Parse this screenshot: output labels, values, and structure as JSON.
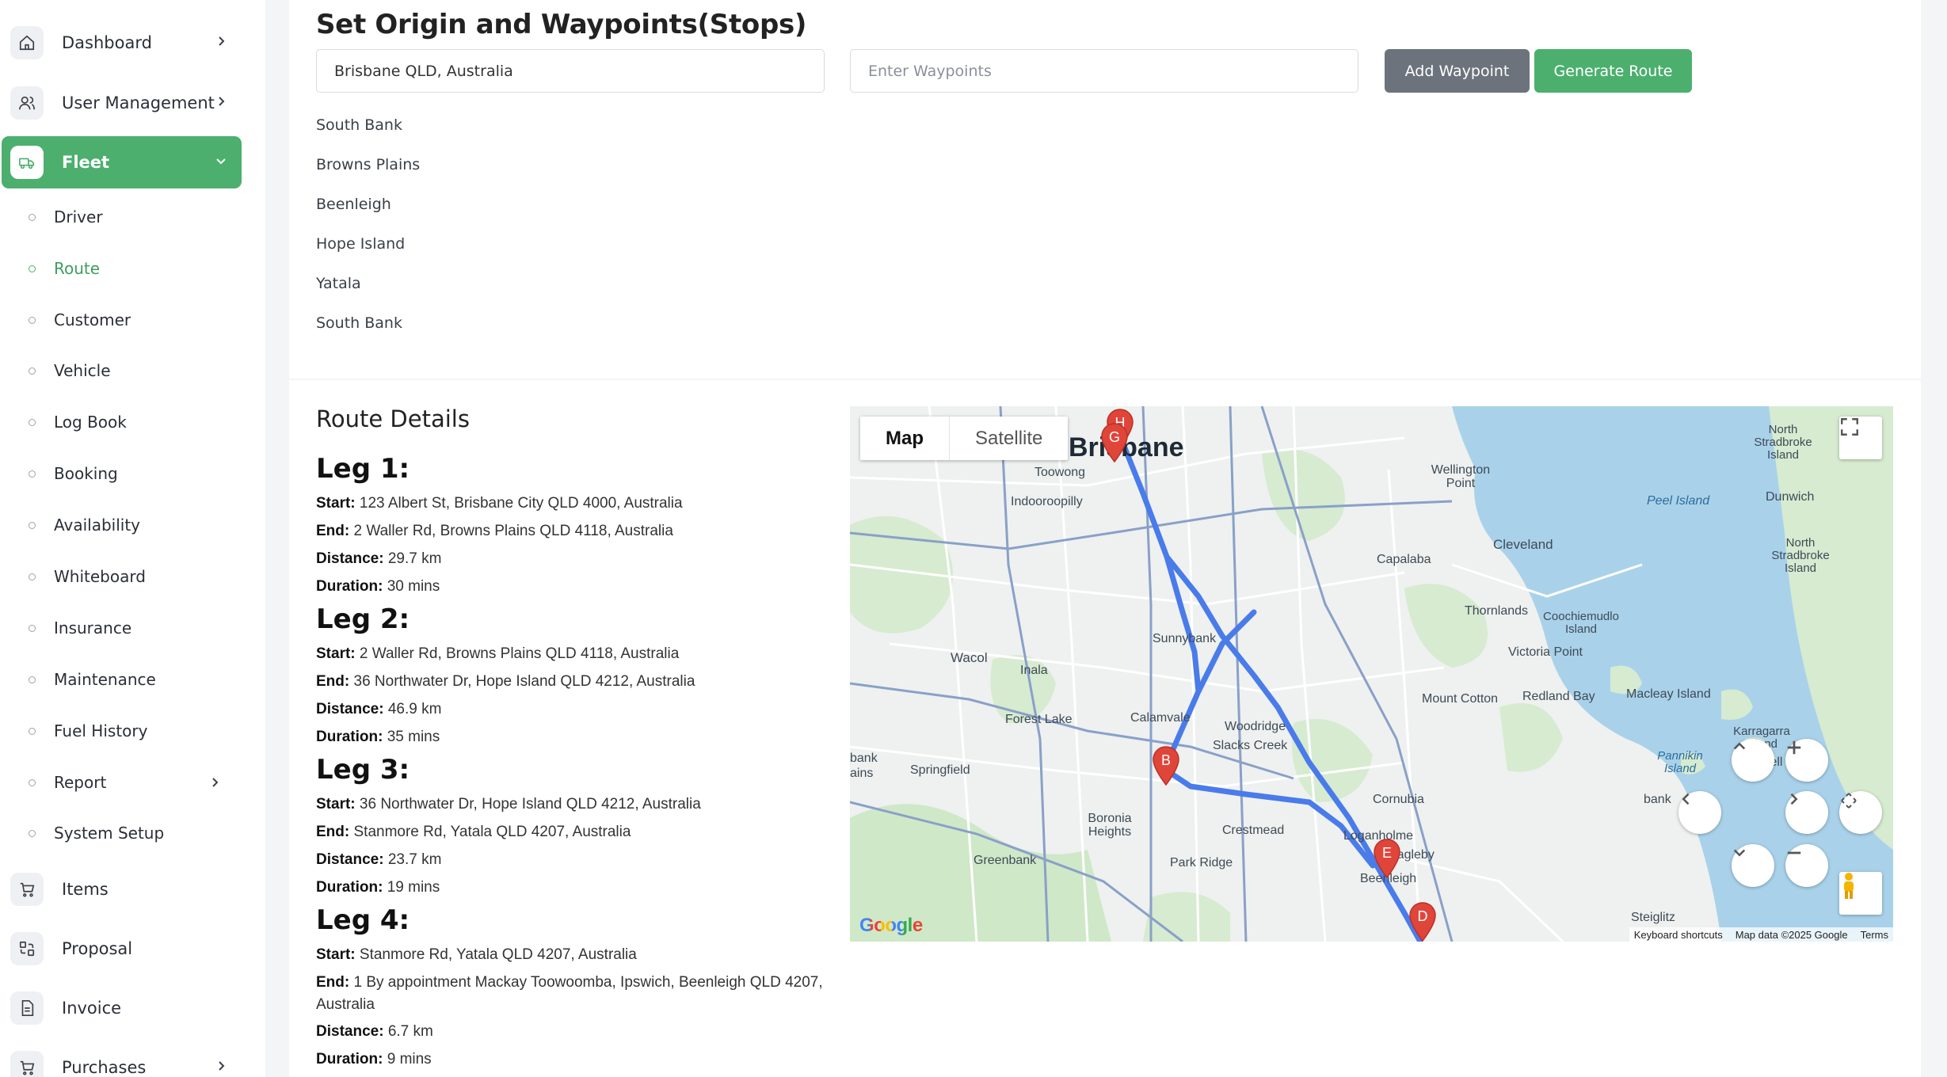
{
  "sidebar": {
    "main_items": [
      {
        "label": "Dashboard",
        "icon": "home-icon"
      },
      {
        "label": "User Management",
        "icon": "users-icon"
      },
      {
        "label": "Fleet",
        "icon": "truck-icon"
      },
      {
        "label": "Items",
        "icon": "cart-icon"
      },
      {
        "label": "Proposal",
        "icon": "proposal-icon"
      },
      {
        "label": "Invoice",
        "icon": "invoice-icon"
      },
      {
        "label": "Purchases",
        "icon": "cart-icon"
      }
    ],
    "fleet_items": [
      {
        "label": "Driver"
      },
      {
        "label": "Route"
      },
      {
        "label": "Customer"
      },
      {
        "label": "Vehicle"
      },
      {
        "label": "Log Book"
      },
      {
        "label": "Booking"
      },
      {
        "label": "Availability"
      },
      {
        "label": "Whiteboard"
      },
      {
        "label": "Insurance"
      },
      {
        "label": "Maintenance"
      },
      {
        "label": "Fuel History"
      },
      {
        "label": "Report"
      },
      {
        "label": "System Setup"
      }
    ],
    "accent": "#4caf6e"
  },
  "waypoints_form": {
    "title": "Set Origin and Waypoints(Stops)",
    "origin_value": "Brisbane QLD, Australia",
    "waypoint_placeholder": "Enter Waypoints",
    "add_label": "Add Waypoint",
    "generate_label": "Generate Route",
    "waypoints": [
      "South Bank",
      "Browns Plains",
      "Beenleigh",
      "Hope Island",
      "Yatala",
      "South Bank"
    ]
  },
  "route_details": {
    "title": "Route Details",
    "start_label": "Start:",
    "end_label": "End:",
    "distance_label": "Distance:",
    "duration_label": "Duration:",
    "legs": [
      {
        "title": "Leg 1:",
        "start": "123 Albert St, Brisbane City QLD 4000, Australia",
        "end": "2 Waller Rd, Browns Plains QLD 4118, Australia",
        "distance": "29.7 km",
        "duration": "30 mins"
      },
      {
        "title": "Leg 2:",
        "start": "2 Waller Rd, Browns Plains QLD 4118, Australia",
        "end": "36 Northwater Dr, Hope Island QLD 4212, Australia",
        "distance": "46.9 km",
        "duration": "35 mins"
      },
      {
        "title": "Leg 3:",
        "start": "36 Northwater Dr, Hope Island QLD 4212, Australia",
        "end": "Stanmore Rd, Yatala QLD 4207, Australia",
        "distance": "23.7 km",
        "duration": "19 mins"
      },
      {
        "title": "Leg 4:",
        "start": "Stanmore Rd, Yatala QLD 4207, Australia",
        "end": "1 By appointment Mackay Toowoomba, Ipswich, Beenleigh QLD 4207, Australia",
        "distance": "6.7 km",
        "duration": "9 mins"
      }
    ]
  },
  "map": {
    "type_map": "Map",
    "type_satellite": "Satellite",
    "logo": "Google",
    "footer_shortcuts": "Keyboard shortcuts",
    "footer_data": "Map data ©2025 Google",
    "footer_terms": "Terms",
    "route_color": "#4a7bea",
    "marker_color": "#e0453a",
    "markers": [
      "H",
      "G",
      "B",
      "E",
      "D"
    ],
    "places": [
      "Brisbane",
      "Toowong",
      "Indooroopilly",
      "Wellington Point",
      "North Stradbroke Island",
      "Peel Island",
      "Dunwich",
      "Cleveland",
      "Capalaba",
      "Thornlands",
      "Coochiemudlo Island",
      "Victoria Point",
      "Sunnybank",
      "Wacol",
      "Inala",
      "Forest Lake",
      "Calamvale",
      "Woodridge",
      "Slacks Creek",
      "Mount Cotton",
      "Redland Bay",
      "Macleay Island",
      "Karragarra Island",
      "Russell Island",
      "Pannikin Island",
      "Springfield",
      "Boronia Heights",
      "Crestmead",
      "Cornubia",
      "Loganholme",
      "Park Ridge",
      "Greenbank",
      "Eagleby",
      "Beenleigh",
      "Steiglitz",
      "Russe",
      "bank",
      "ains"
    ]
  }
}
